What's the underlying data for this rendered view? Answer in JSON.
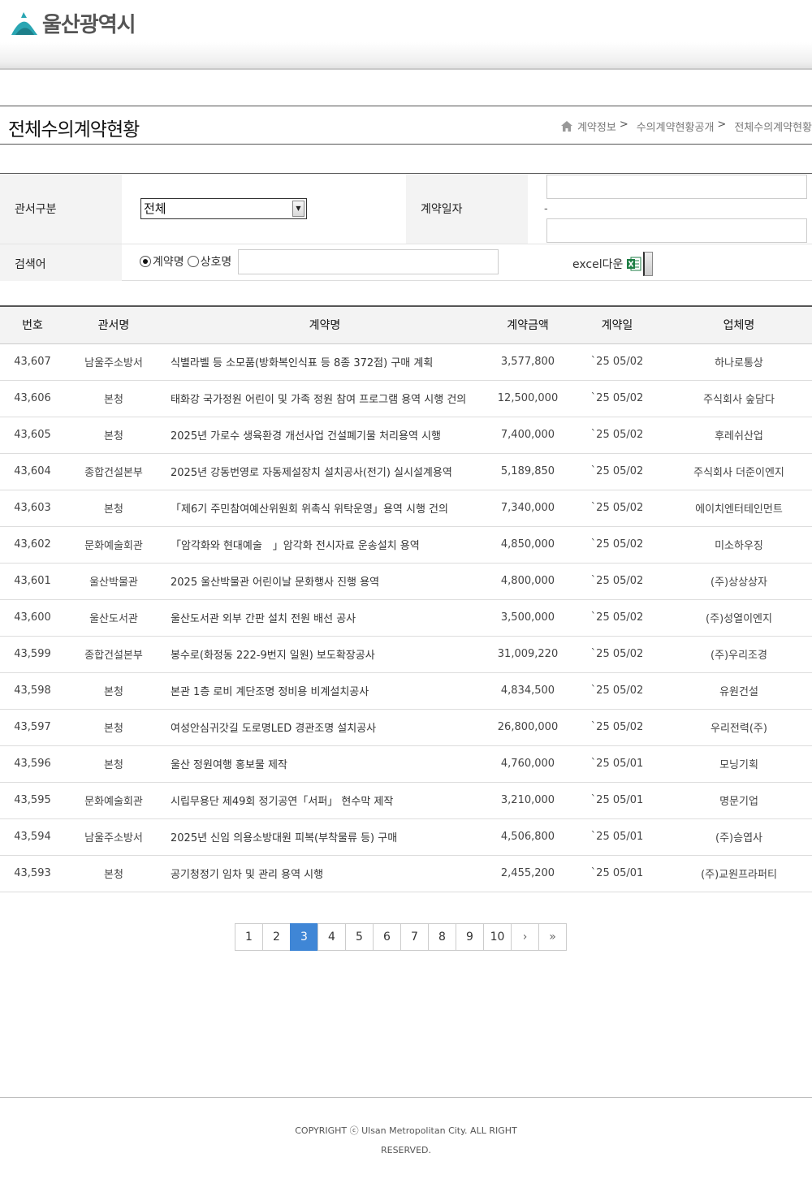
{
  "header": {
    "logo_text": "울산광역시"
  },
  "title_bar": {
    "page_title": "전체수의계약현황",
    "breadcrumb": [
      {
        "label": "계약정보",
        "sep": ">"
      },
      {
        "label": "수의계약현황공개",
        "sep": ">"
      },
      {
        "label": "전체수의계약현황",
        "sep": ""
      }
    ]
  },
  "search_form": {
    "department_label": "관서구분",
    "department_selected": "전체",
    "date_label": "계약일자",
    "date_separator": "-",
    "keyword_label": "검색어",
    "radio_options": [
      {
        "label": "계약명",
        "checked": true
      },
      {
        "label": "상호명",
        "checked": false
      }
    ],
    "excel_label": "excel다운"
  },
  "table": {
    "headers": [
      "번호",
      "관서명",
      "계약명",
      "계약금액",
      "계약일",
      "업체명"
    ],
    "rows": [
      {
        "no": "43,607",
        "dept": "남울주소방서",
        "name": "식별라벨 등 소모품(방화복인식표 등 8종 372점) 구매 계획",
        "amount": "3,577,800",
        "date": "`25 05/02",
        "company": "하나로통상"
      },
      {
        "no": "43,606",
        "dept": "본청",
        "name": "태화강 국가정원 어린이 및 가족 정원 참여 프로그램 용역 시행 건의",
        "amount": "12,500,000",
        "date": "`25 05/02",
        "company": "주식회사 숲담다"
      },
      {
        "no": "43,605",
        "dept": "본청",
        "name": "2025년 가로수 생육환경 개선사업 건설폐기물 처리용역 시행",
        "amount": "7,400,000",
        "date": "`25 05/02",
        "company": "후레쉬산업"
      },
      {
        "no": "43,604",
        "dept": "종합건설본부",
        "name": "2025년 강동번영로 자동제설장치 설치공사(전기) 실시설계용역",
        "amount": "5,189,850",
        "date": "`25 05/02",
        "company": "주식회사 더준이엔지"
      },
      {
        "no": "43,603",
        "dept": "본청",
        "name": "「제6기 주민참여예산위원회 위촉식 위탁운영」용역 시행 건의",
        "amount": "7,340,000",
        "date": "`25 05/02",
        "company": "에이치엔터테인먼트"
      },
      {
        "no": "43,602",
        "dept": "문화예술회관",
        "name": "「암각화와 현대예술　」암각화 전시자료 운송설치 용역",
        "amount": "4,850,000",
        "date": "`25 05/02",
        "company": "미소하우징"
      },
      {
        "no": "43,601",
        "dept": "울산박물관",
        "name": "2025 울산박물관 어린이날 문화행사 진행 용역",
        "amount": "4,800,000",
        "date": "`25 05/02",
        "company": "(주)상상상자"
      },
      {
        "no": "43,600",
        "dept": "울산도서관",
        "name": "울산도서관 외부 간판 설치 전원 배선 공사",
        "amount": "3,500,000",
        "date": "`25 05/02",
        "company": "(주)성열이엔지"
      },
      {
        "no": "43,599",
        "dept": "종합건설본부",
        "name": "봉수로(화정동 222-9번지 일원) 보도확장공사",
        "amount": "31,009,220",
        "date": "`25 05/02",
        "company": "(주)우리조경"
      },
      {
        "no": "43,598",
        "dept": "본청",
        "name": "본관 1층 로비 계단조명 정비용 비계설치공사",
        "amount": "4,834,500",
        "date": "`25 05/02",
        "company": "유원건설"
      },
      {
        "no": "43,597",
        "dept": "본청",
        "name": "여성안심귀갓길 도로명LED 경관조명 설치공사",
        "amount": "26,800,000",
        "date": "`25 05/02",
        "company": "우리전력(주)"
      },
      {
        "no": "43,596",
        "dept": "본청",
        "name": "울산 정원여행 홍보물 제작",
        "amount": "4,760,000",
        "date": "`25 05/01",
        "company": "모닝기획"
      },
      {
        "no": "43,595",
        "dept": "문화예술회관",
        "name": "시립무용단 제49회 정기공연「서퍼」 현수막 제작",
        "amount": "3,210,000",
        "date": "`25 05/01",
        "company": "명문기업"
      },
      {
        "no": "43,594",
        "dept": "남울주소방서",
        "name": "2025년 신임 의용소방대원 피복(부착물류 등) 구매",
        "amount": "4,506,800",
        "date": "`25 05/01",
        "company": "(주)승엽사"
      },
      {
        "no": "43,593",
        "dept": "본청",
        "name": "공기청정기 임차 및 관리 용역 시행",
        "amount": "2,455,200",
        "date": "`25 05/01",
        "company": "(주)교원프라퍼티"
      }
    ]
  },
  "pagination": {
    "pages": [
      "1",
      "2",
      "3",
      "4",
      "5",
      "6",
      "7",
      "8",
      "9",
      "10"
    ],
    "current": "3",
    "next_label": "›",
    "last_label": "»"
  },
  "footer": {
    "copyright": "COPYRIGHT ⓒ Ulsan Metropolitan City. ALL RIGHT RESERVED."
  },
  "colors": {
    "logo_teal": "#2aa6b3",
    "active_page": "#3f86d6",
    "excel_green": "#1e7e45"
  }
}
